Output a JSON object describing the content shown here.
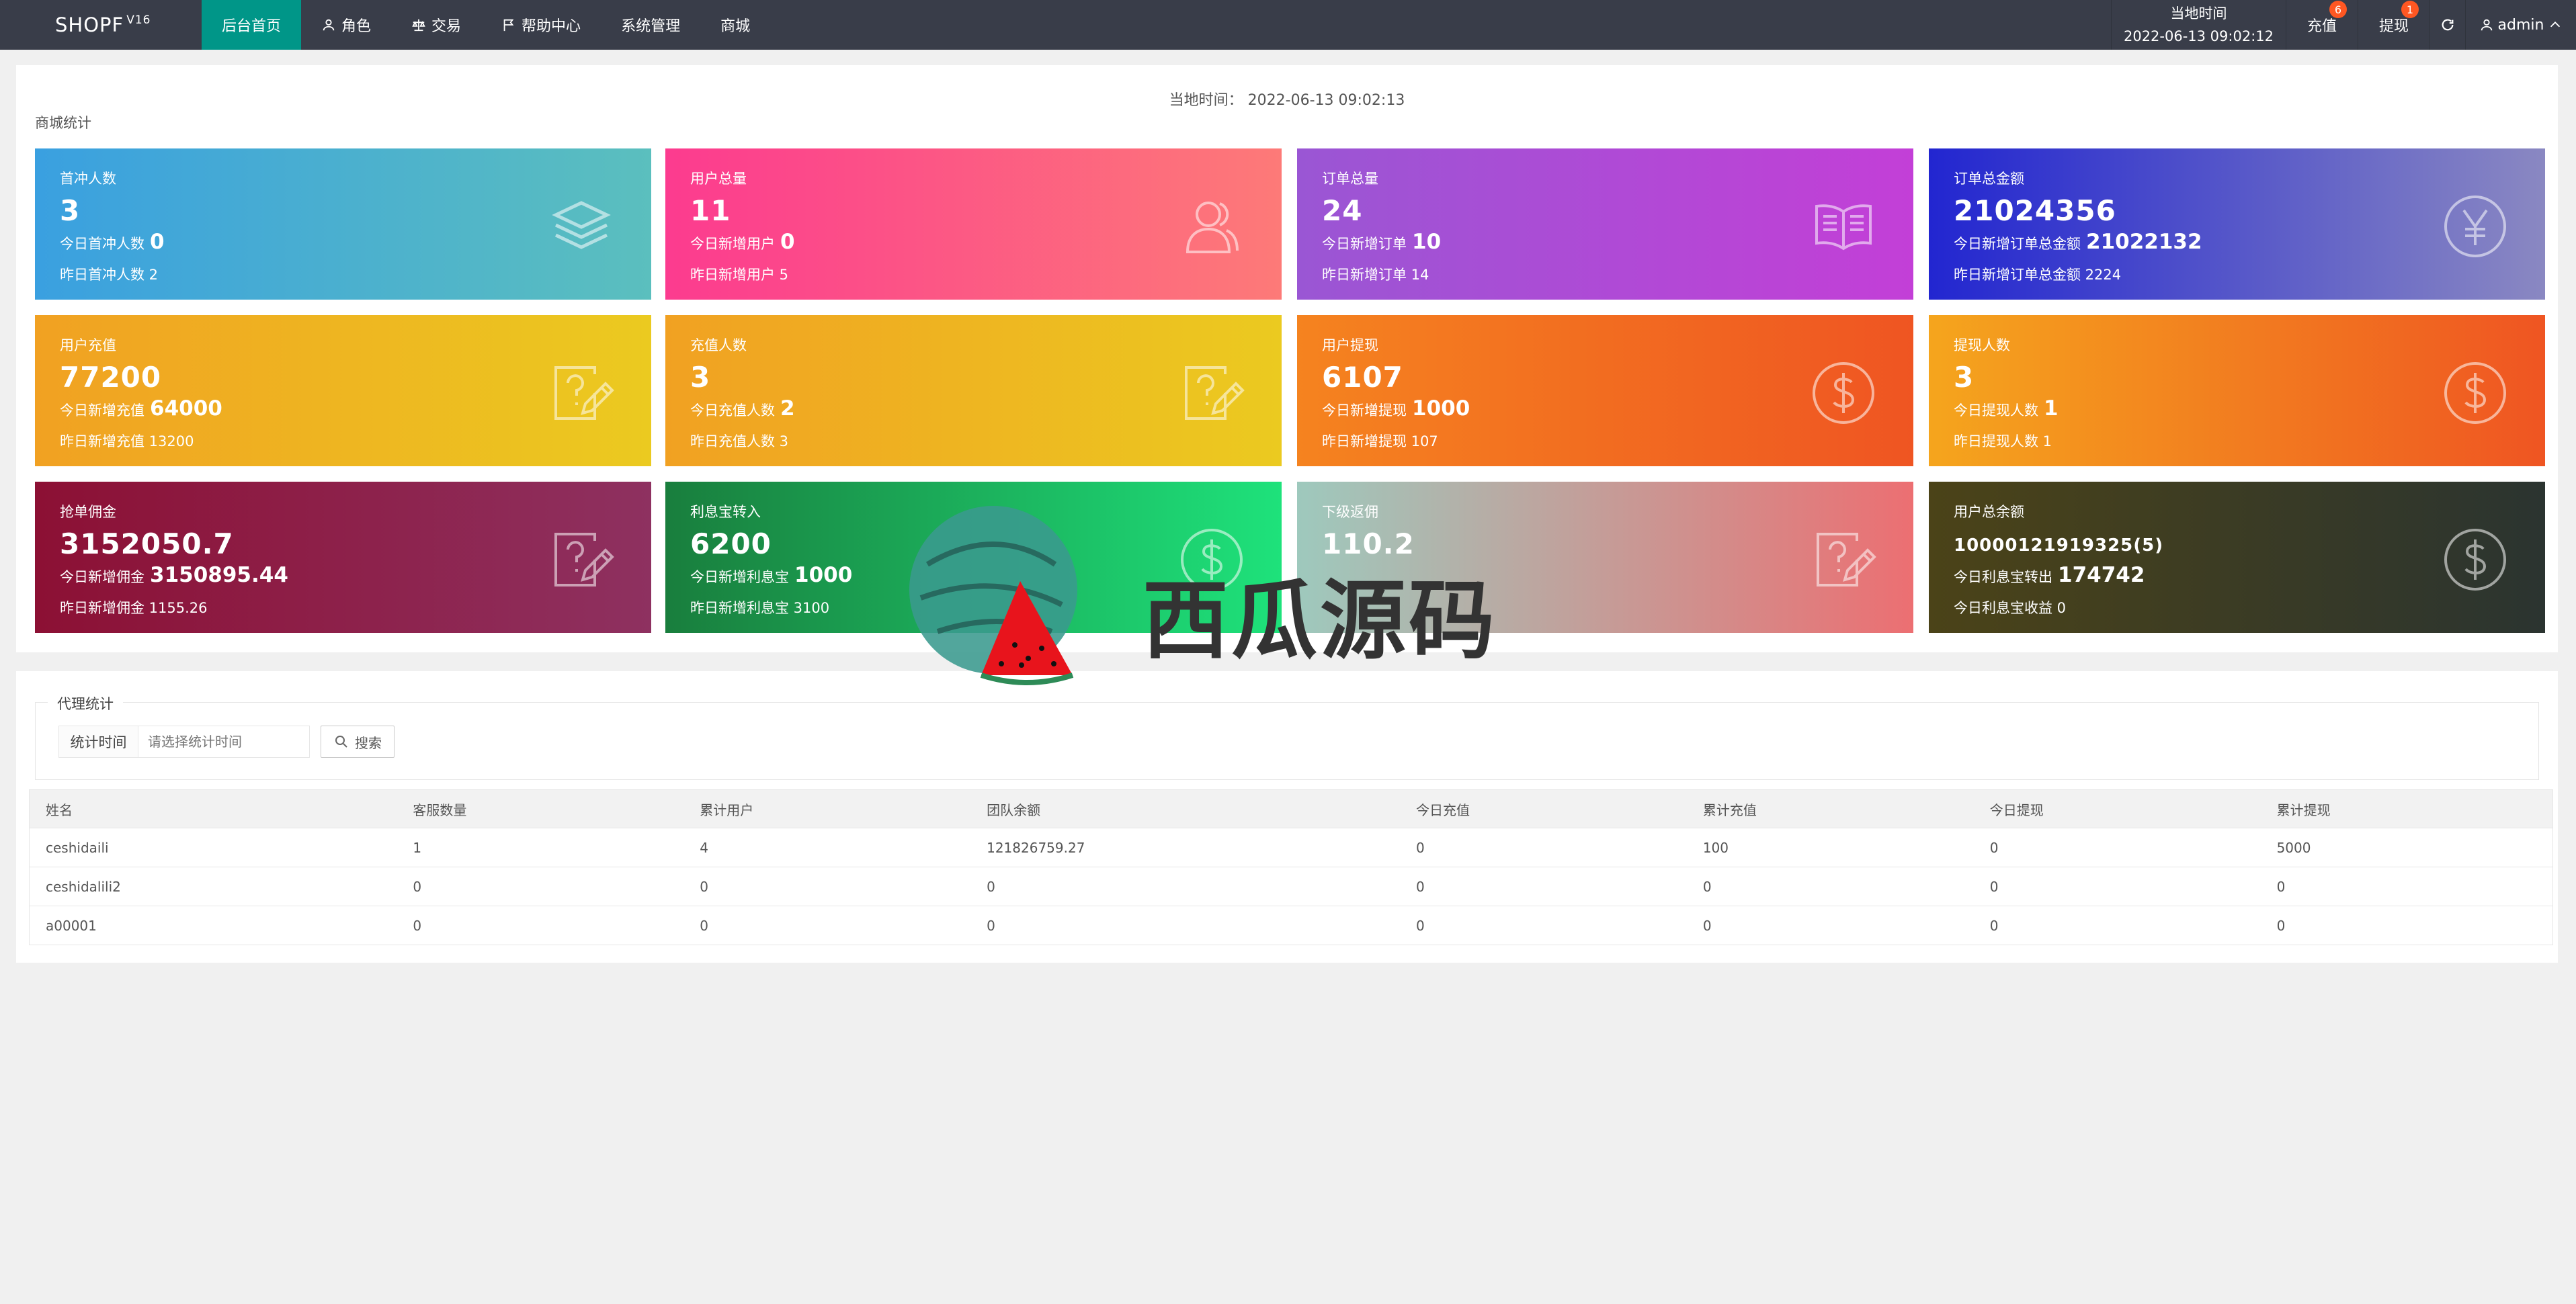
{
  "header": {
    "logo": "SHOPF",
    "version": "V16",
    "nav": [
      {
        "label": "后台首页",
        "icon": "",
        "active": true
      },
      {
        "label": "角色",
        "icon": "user-icon"
      },
      {
        "label": "交易",
        "icon": "scale-icon"
      },
      {
        "label": "帮助中心",
        "icon": "flag-icon"
      },
      {
        "label": "系统管理",
        "icon": ""
      },
      {
        "label": "商城",
        "icon": ""
      }
    ],
    "time_label": "当地时间",
    "time_value": "2022-06-13 09:02:12",
    "recharge_label": "充值",
    "recharge_badge": "6",
    "withdraw_label": "提现",
    "withdraw_badge": "1",
    "user": "admin"
  },
  "stats": {
    "local_time": "当地时间：  2022-06-13 09:02:13",
    "section_title": "商城统计",
    "cards": [
      {
        "title": "首冲人数",
        "value": "3",
        "line1_label": "今日首冲人数",
        "line1_value": "0",
        "line2": "昨日首冲人数 2",
        "icon": "layers-icon",
        "colors": [
          "#3aa0e0",
          "#5bbfbe"
        ]
      },
      {
        "title": "用户总量",
        "value": "11",
        "line1_label": "今日新增用户",
        "line1_value": "0",
        "line2": "昨日新增用户 5",
        "icon": "users-icon",
        "colors": [
          "#fc3b8f",
          "#fd7a78"
        ]
      },
      {
        "title": "订单总量",
        "value": "24",
        "line1_label": "今日新增订单",
        "line1_value": "10",
        "line2": "昨日新增订单 14",
        "icon": "book-icon",
        "colors": [
          "#9a56d4",
          "#c33fd7"
        ]
      },
      {
        "title": "订单总金额",
        "value": "21024356",
        "line1_label": "今日新增订单总金额",
        "line1_value": "21022132",
        "line2": "昨日新增订单总金额 2224",
        "icon": "yen-icon",
        "colors": [
          "#2226d0",
          "#8a88c2"
        ]
      },
      {
        "title": "用户充值",
        "value": "77200",
        "line1_label": "今日新增充值",
        "line1_value": "64000",
        "line2": "昨日新增充值 13200",
        "icon": "edit-question-icon",
        "colors": [
          "#f1a122",
          "#ebca20"
        ]
      },
      {
        "title": "充值人数",
        "value": "3",
        "line1_label": "今日充值人数",
        "line1_value": "2",
        "line2": "昨日充值人数 3",
        "icon": "edit-question-icon",
        "colors": [
          "#f1a122",
          "#ebca20"
        ]
      },
      {
        "title": "用户提现",
        "value": "6107",
        "line1_label": "今日新增提现",
        "line1_value": "1000",
        "line2": "昨日新增提现 107",
        "icon": "dollar-icon",
        "colors": [
          "#f5831f",
          "#ef5522"
        ]
      },
      {
        "title": "提现人数",
        "value": "3",
        "line1_label": "今日提现人数",
        "line1_value": "1",
        "line2": "昨日提现人数 1",
        "icon": "dollar-icon",
        "colors": [
          "#f5a51d",
          "#ef5522"
        ]
      },
      {
        "title": "抢单佣金",
        "value": "3152050.7",
        "line1_label": "今日新增佣金",
        "line1_value": "3150895.44",
        "line2": "昨日新增佣金 1155.26",
        "icon": "edit-question-icon",
        "colors": [
          "#8c1034",
          "#8e3160"
        ]
      },
      {
        "title": "利息宝转入",
        "value": "6200",
        "line1_label": "今日新增利息宝",
        "line1_value": "1000",
        "line2": "昨日新增利息宝 3100",
        "icon": "dollar-icon",
        "colors": [
          "#197e3d",
          "#1ee27b"
        ]
      },
      {
        "title": "下级返佣",
        "value": "110.2",
        "line1_label": "",
        "line1_value": "",
        "line2": "",
        "icon": "edit-question-icon",
        "colors": [
          "#9ec9bd",
          "#ec6f72"
        ]
      },
      {
        "title": "用户总余额",
        "value": "10000121919325(5)",
        "line1_label": "今日利息宝转出",
        "line1_value": "174742",
        "line2": "今日利息宝收益 0",
        "icon": "dollar-icon",
        "colors": [
          "#4b4318",
          "#2b3430"
        ]
      }
    ]
  },
  "agent": {
    "legend": "代理统计",
    "search_label": "统计时间",
    "search_placeholder": "请选择统计时间",
    "search_button": "搜索",
    "columns": [
      "姓名",
      "客服数量",
      "累计用户",
      "团队余额",
      "今日充值",
      "累计充值",
      "今日提现",
      "累计提现"
    ],
    "rows": [
      [
        "ceshidaili",
        "1",
        "4",
        "121826759.27",
        "0",
        "100",
        "0",
        "5000"
      ],
      [
        "ceshidalili2",
        "0",
        "0",
        "0",
        "0",
        "0",
        "0",
        "0"
      ],
      [
        "a00001",
        "0",
        "0",
        "0",
        "0",
        "0",
        "0",
        "0"
      ]
    ]
  },
  "watermark": "西瓜源码"
}
